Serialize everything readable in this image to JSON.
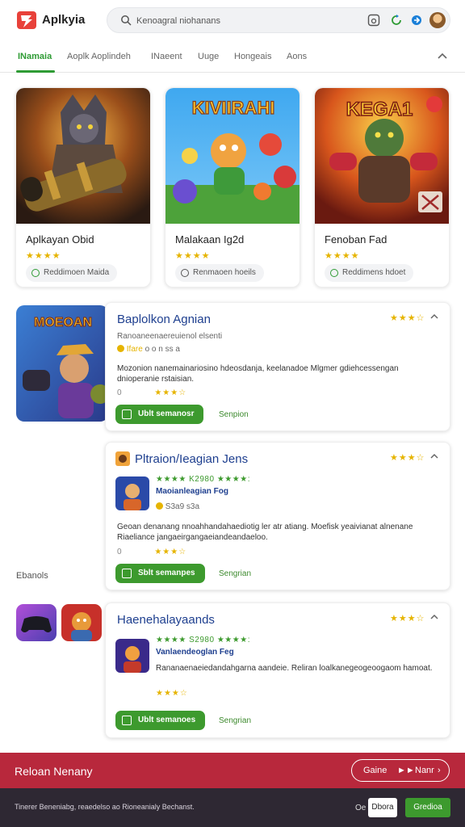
{
  "header": {
    "brand": "Aplkyia",
    "search_placeholder": "Kenoagral niohanans",
    "search_value": "Kenoagral niohanans"
  },
  "tabs": [
    {
      "label": "INamaia"
    },
    {
      "label": "Aoplk Aoplindeh"
    },
    {
      "label": "INaeent"
    },
    {
      "label": "Uuge"
    },
    {
      "label": "Hongeais"
    },
    {
      "label": "Aons"
    }
  ],
  "top_cards": [
    {
      "title": "Aplkayan Obid",
      "stars": "★★★★",
      "pill": "Reddimoen Maida"
    },
    {
      "title": "Malakaan Ig2d",
      "stars": "★★★★",
      "pill": "Renmaoen hoeils"
    },
    {
      "title": "Fenoban Fad",
      "stars": "★★★★",
      "pill": "Reddimens hdoet"
    }
  ],
  "art_text": {
    "card2": "KIVIIRAHI",
    "card3": "KEGA1",
    "leftthumb": "MOEOAN"
  },
  "detail_cards": [
    {
      "title": "Baplolkon Agnian",
      "stars": "★★★☆",
      "subline": "Ranoaneenaereuienol elsenti",
      "meta_tag": "Ifare",
      "meta_text": "o o n ss a",
      "description": "Mozonion nanemainariosino hdeosdanja, keelanadoe Mlgmer gdiehcessengan dnioperanie rstaisian.",
      "rating_left": "0",
      "row_stars": "★★★☆",
      "button": "Ublt semanosr",
      "link": "Senpion"
    },
    {
      "title": "Pltraion/Ieagian Jens",
      "stars": "★★★☆",
      "app_green": "★★★★ K2980 ★★★★:",
      "app_name": "Maoianleagian Fog",
      "app_meta": "S3a9 s3a",
      "description": "Geoan denanang nnoahhandahaediotig ler atr atiang. Moefisk yeaivianat alnenane Riaeliance jangaeirgangaeiandeandaeloo.",
      "rating_left": "0",
      "row_stars": "★★★☆",
      "button": "Sblt semanpes",
      "link": "Sengrian"
    },
    {
      "title": "Haenehalayaands",
      "stars": "★★★☆",
      "app_green": "★★★★ S2980 ★★★★:",
      "app_name": "Vanlaendeoglan Feg",
      "description": "Rananaenaeiedandahgarna aandeie. Reliran loalkanegeogeoogaom hamoat.",
      "row_stars": "★★★☆",
      "button": "Ublt semanoes",
      "link": "Sengrian"
    }
  ],
  "section_label": "Ebanols",
  "red_bar": {
    "text": "Reloan Nenany",
    "button_left": "Gaine",
    "button_right": "Nanr"
  },
  "dark_bar": {
    "text": "Tinerer Beneniabg, reaedelso ao Rioneanialy Bechanst.",
    "cancel": "Oe",
    "white_button": "Dbora",
    "green_button": "Gredioa"
  },
  "colors": {
    "accent_green": "#2e9b34",
    "title_blue": "#1e3f8f",
    "star_gold": "#e6b400",
    "red_bar": "#b8283c",
    "dark_bar": "#2e2833"
  }
}
